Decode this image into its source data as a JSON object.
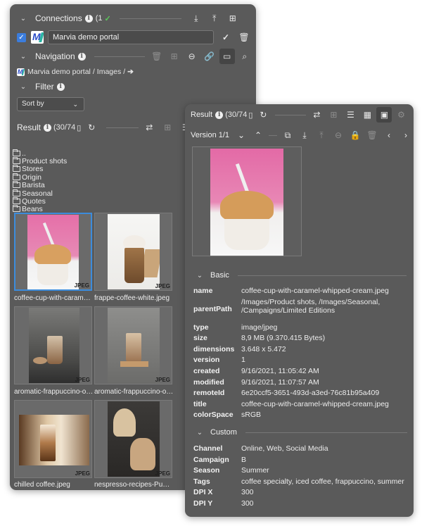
{
  "left": {
    "connections": {
      "title": "Connections",
      "count": "(1",
      "status": "✓"
    },
    "portal": {
      "name": "Marvia demo portal"
    },
    "navigation": {
      "title": "Navigation"
    },
    "breadcrumb": {
      "root": "Marvia demo portal",
      "sep1": "/",
      "folder": "Images",
      "sep2": "/"
    },
    "filter": {
      "title": "Filter",
      "sort_label": "Sort by"
    },
    "result": {
      "title": "Result",
      "count": "(30/74"
    },
    "folders": [
      "..",
      "Product shots",
      "Stores",
      "Origin",
      "Barista",
      "Seasonal",
      "Quotes",
      "Beans"
    ],
    "thumbs": [
      {
        "caption": "coffee-cup-with-caramel-whipped-cream.jpeg",
        "badge": "JPEG"
      },
      {
        "caption": "frappe-coffee-white.jpeg",
        "badge": "JPEG"
      },
      {
        "caption": "aromatic-frappuccino-on-table.jpeg",
        "badge": "JPEG"
      },
      {
        "caption": "aromatic-frappuccino-on-board.jpeg",
        "badge": "JPEG"
      },
      {
        "caption": "chilled coffee.jpeg",
        "badge": "JPEG"
      },
      {
        "caption": "nespresso-recipes-Pumpkin.jpeg",
        "badge": "JPEG"
      }
    ]
  },
  "right": {
    "result": {
      "title": "Result",
      "count": "(30/74"
    },
    "version": {
      "label": "Version 1/1"
    },
    "basic": {
      "title": "Basic",
      "rows": [
        {
          "k": "name",
          "v": "coffee-cup-with-caramel-whipped-cream.jpeg"
        },
        {
          "k": "parentPath",
          "v": "/Images/Product shots, /Images/Seasonal, /Campaigns/Limited Editions"
        },
        {
          "k": "type",
          "v": "image/jpeg"
        },
        {
          "k": "size",
          "v": "8,9 MB (9.370.415 Bytes)"
        },
        {
          "k": "dimensions",
          "v": "3.648 x 5.472"
        },
        {
          "k": "version",
          "v": "1"
        },
        {
          "k": "created",
          "v": "9/16/2021, 11:05:42 AM"
        },
        {
          "k": "modified",
          "v": "9/16/2021, 11:07:57 AM"
        },
        {
          "k": "remoteId",
          "v": "6e20ccf5-3651-493d-a3ed-76c81b95a409"
        },
        {
          "k": "title",
          "v": "coffee-cup-with-caramel-whipped-cream.jpeg"
        },
        {
          "k": "colorSpace",
          "v": "sRGB"
        }
      ]
    },
    "custom": {
      "title": "Custom",
      "rows": [
        {
          "k": "Channel",
          "v": "Online, Web, Social Media"
        },
        {
          "k": "Campaign",
          "v": "B"
        },
        {
          "k": "Season",
          "v": "Summer"
        },
        {
          "k": "Tags",
          "v": "coffee specialty, iced coffee, frappuccino, summer"
        },
        {
          "k": "DPI X",
          "v": "300"
        },
        {
          "k": "DPI Y",
          "v": "300"
        }
      ]
    }
  },
  "colors": {
    "panel": "#5a5a5a",
    "selection": "#3c8cdc",
    "success": "#5ac85a",
    "checkbox": "#3b7ddd"
  }
}
